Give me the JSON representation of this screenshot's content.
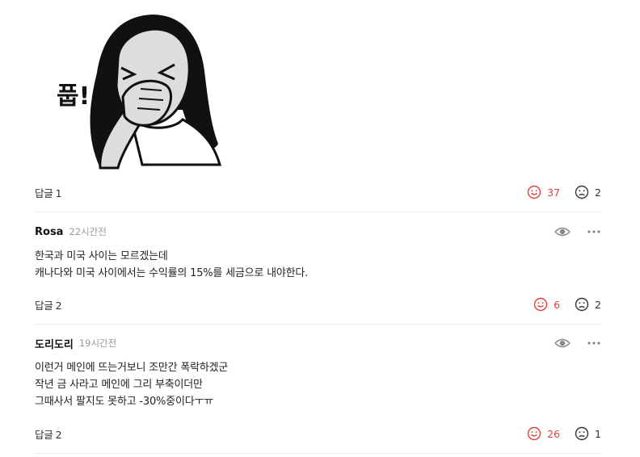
{
  "sticker": {
    "text": "풉!"
  },
  "top_post": {
    "reply_label": "답글",
    "reply_count": "1",
    "likes": "37",
    "dislikes": "2"
  },
  "comments": [
    {
      "author": "Rosa",
      "time": "22시간전",
      "lines": [
        "한국과 미국 사이는 모르겠는데",
        "캐나다와 미국 사이에서는 수익률의 15%를 세금으로 내야한다."
      ],
      "reply_label": "답글",
      "reply_count": "2",
      "likes": "6",
      "dislikes": "2"
    },
    {
      "author": "도리도리",
      "time": "19시간전",
      "lines": [
        "이런거 메인에 뜨는거보니 조만간 폭락하겠군",
        "작년 금 사라고 메인에 그리 부축이더만",
        "그때사서 팔지도 못하고 -30%중이다ㅜㅠ"
      ],
      "reply_label": "답글",
      "reply_count": "2",
      "likes": "26",
      "dislikes": "1"
    }
  ],
  "colors": {
    "like": "#e0413a",
    "neutral": "#333333",
    "muted": "#999999",
    "divider": "#ececec"
  },
  "icons": {
    "like": "smile-icon",
    "dislike": "frown-icon",
    "view": "eye-icon",
    "more": "more-icon"
  }
}
